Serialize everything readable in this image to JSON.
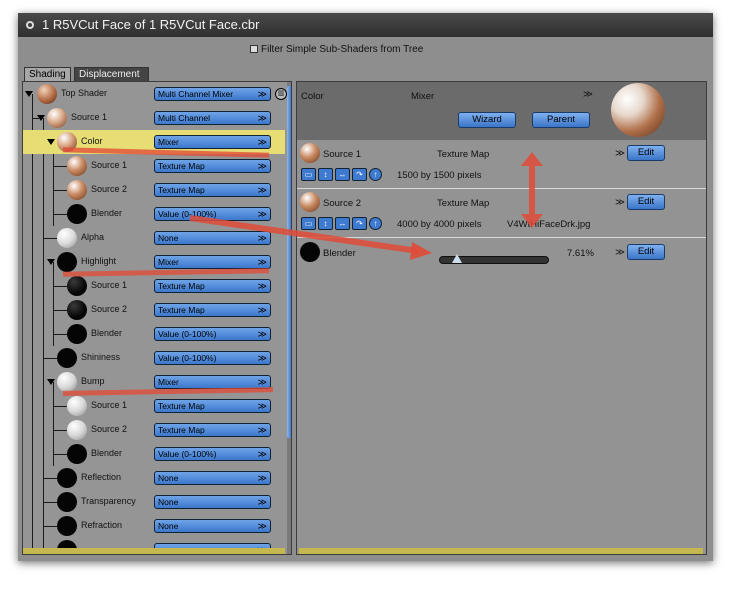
{
  "window": {
    "title": "1  R5VCut Face of 1  R5VCut Face.cbr"
  },
  "filter_label": "Filter Simple Sub-Shaders from Tree",
  "tabs": [
    {
      "label": "Shading",
      "active": true
    },
    {
      "label": "Displacement",
      "active": false
    }
  ],
  "tree": {
    "rows": [
      {
        "label": "Top Shader",
        "value": "Multi Channel Mixer",
        "ball": "brown"
      },
      {
        "label": "Source 1",
        "value": "Multi Channel",
        "ball": "brown"
      },
      {
        "label": "Color",
        "value": "Mixer",
        "ball": "brown",
        "selected": true
      },
      {
        "label": "Source 1",
        "value": "Texture Map",
        "ball": "brown"
      },
      {
        "label": "Source 2",
        "value": "Texture Map",
        "ball": "brown"
      },
      {
        "label": "Blender",
        "value": "Value (0-100%)",
        "ball": "black"
      },
      {
        "label": "Alpha",
        "value": "None",
        "ball": "white"
      },
      {
        "label": "Highlight",
        "value": "Mixer",
        "ball": "black"
      },
      {
        "label": "Source 1",
        "value": "Texture Map",
        "ball": "black"
      },
      {
        "label": "Source 2",
        "value": "Texture Map",
        "ball": "black"
      },
      {
        "label": "Blender",
        "value": "Value (0-100%)",
        "ball": "black"
      },
      {
        "label": "Shininess",
        "value": "Value (0-100%)",
        "ball": "black"
      },
      {
        "label": "Bump",
        "value": "Mixer",
        "ball": "white"
      },
      {
        "label": "Source 1",
        "value": "Texture Map",
        "ball": "white"
      },
      {
        "label": "Source 2",
        "value": "Texture Map",
        "ball": "white"
      },
      {
        "label": "Blender",
        "value": "Value (0-100%)",
        "ball": "black"
      },
      {
        "label": "Reflection",
        "value": "None",
        "ball": "black"
      },
      {
        "label": "Transparency",
        "value": "None",
        "ball": "black"
      },
      {
        "label": "Refraction",
        "value": "None",
        "ball": "black"
      }
    ]
  },
  "detail": {
    "channel": "Color",
    "type": "Mixer",
    "wizard_label": "Wizard",
    "parent_label": "Parent",
    "source1": {
      "label": "Source 1",
      "type": "Texture Map",
      "size": "1500 by 1500 pixels",
      "edit": "Edit"
    },
    "source2": {
      "label": "Source 2",
      "type": "Texture Map",
      "size": "4000 by 4000 pixels",
      "file": "V4WtHiFaceDrk.jpg",
      "edit": "Edit"
    },
    "blender": {
      "label": "Blender",
      "value_text": "7.61%",
      "value": 0.0761,
      "edit": "Edit"
    }
  },
  "colors": {
    "accent": "#3c78cc",
    "selected": "#e6dd74",
    "annotation": "#e14b37"
  }
}
